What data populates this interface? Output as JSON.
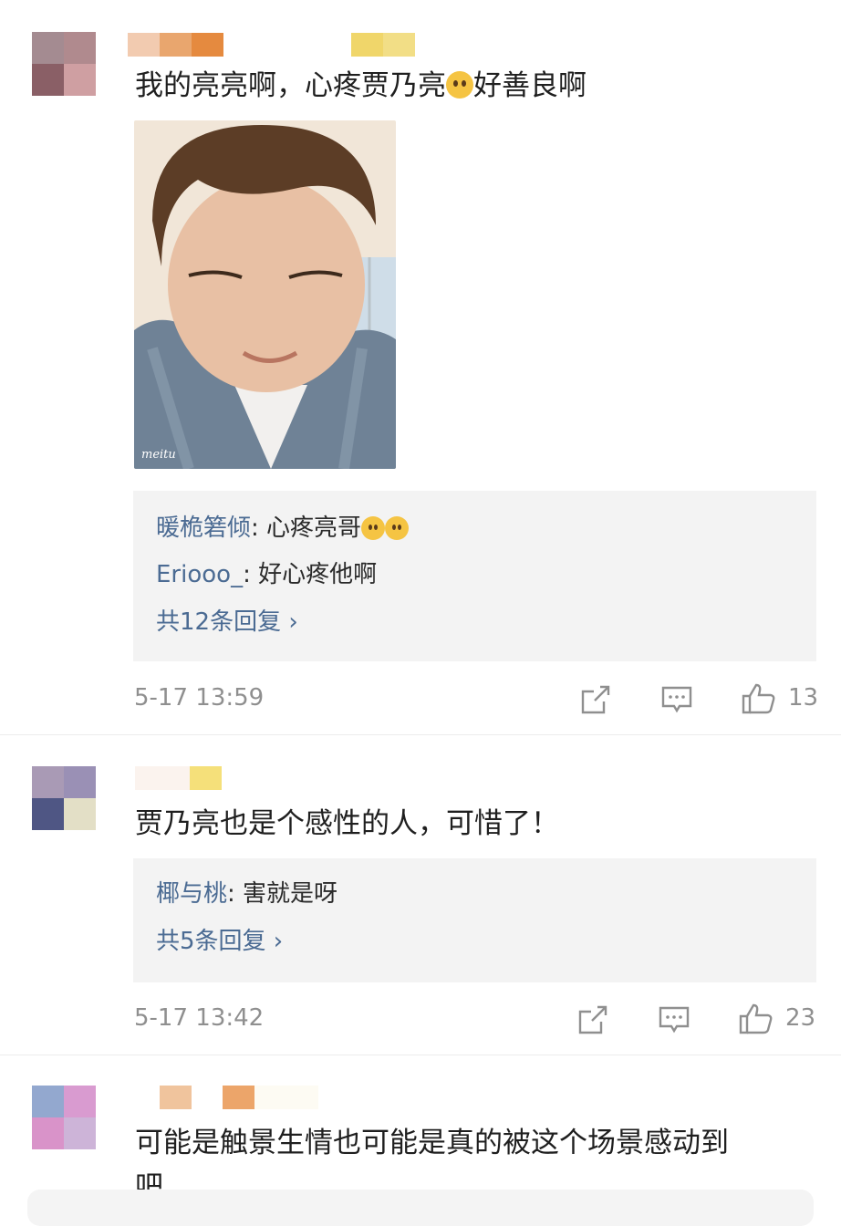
{
  "comments": [
    {
      "text": "我的亮亮啊，心疼贾乃亮",
      "text_after_emoji": "好善良啊",
      "replies": [
        {
          "user": "暖桅箬倾",
          "sep": ":",
          "text": " 心疼亮哥"
        },
        {
          "user": "Eriooo_",
          "sep": ":",
          "text": " 好心疼他啊"
        }
      ],
      "more_replies": "共12条回复 ›",
      "time": "5-17 13:59",
      "likes": "13"
    },
    {
      "text": "贾乃亮也是个感性的人，可惜了！",
      "replies": [
        {
          "user": "椰与桃",
          "sep": ":",
          "text": " 害就是呀"
        }
      ],
      "more_replies": "共5条回复 ›",
      "time": "5-17 13:42",
      "likes": "23"
    },
    {
      "text": "可能是触景生情也可能是真的被这个场景感动到",
      "text_line2": "吧"
    }
  ],
  "photo_watermark": "meitu",
  "colors": {
    "link_blue": "#4b6b93",
    "meta_gray": "#8f8f8f",
    "reply_bg": "#f3f3f3"
  }
}
